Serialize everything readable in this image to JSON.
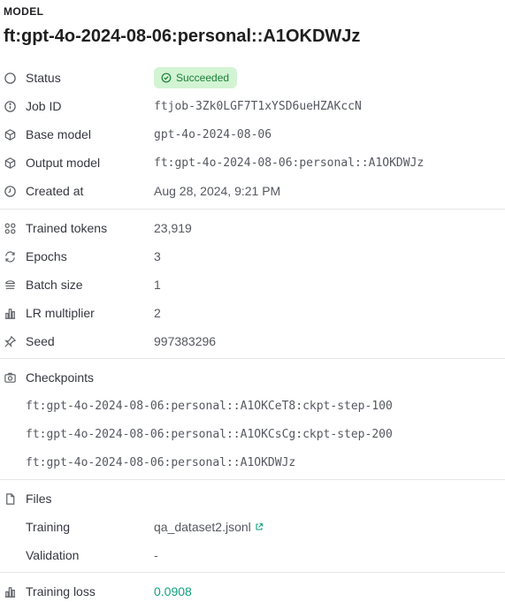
{
  "header": {
    "label": "MODEL",
    "title": "ft:gpt-4o-2024-08-06:personal::A1OKDWJz"
  },
  "details": {
    "status": {
      "label": "Status",
      "value": "Succeeded",
      "icon": "circle-icon"
    },
    "job_id": {
      "label": "Job ID",
      "value": "ftjob-3Zk0LGF7T1xYSD6ueHZAKccN",
      "icon": "info-icon"
    },
    "base_model": {
      "label": "Base model",
      "value": "gpt-4o-2024-08-06",
      "icon": "cube-icon"
    },
    "output_model": {
      "label": "Output model",
      "value": "ft:gpt-4o-2024-08-06:personal::A1OKDWJz",
      "icon": "cube-icon"
    },
    "created_at": {
      "label": "Created at",
      "value": "Aug 28, 2024, 9:21 PM",
      "icon": "clock-icon"
    }
  },
  "training": {
    "trained_tokens": {
      "label": "Trained tokens",
      "value": "23,919",
      "icon": "tokens-icon"
    },
    "epochs": {
      "label": "Epochs",
      "value": "3",
      "icon": "repeat-icon"
    },
    "batch_size": {
      "label": "Batch size",
      "value": "1",
      "icon": "stack-icon"
    },
    "lr_multiplier": {
      "label": "LR multiplier",
      "value": "2",
      "icon": "bar-chart-icon"
    },
    "seed": {
      "label": "Seed",
      "value": "997383296",
      "icon": "pin-icon"
    }
  },
  "checkpoints": {
    "label": "Checkpoints",
    "icon": "camera-icon",
    "items": [
      "ft:gpt-4o-2024-08-06:personal::A1OKCeT8:ckpt-step-100",
      "ft:gpt-4o-2024-08-06:personal::A1OKCsCg:ckpt-step-200",
      "ft:gpt-4o-2024-08-06:personal::A1OKDWJz"
    ]
  },
  "files": {
    "label": "Files",
    "icon": "file-icon",
    "training_label": "Training",
    "training_value": "qa_dataset2.jsonl",
    "validation_label": "Validation",
    "validation_value": "-"
  },
  "metrics": {
    "training_loss": {
      "label": "Training loss",
      "value": "0.0908",
      "icon": "bar-chart-icon"
    }
  },
  "colors": {
    "accent": "#10a37f",
    "badge_bg": "#d2f4d3",
    "badge_text": "#1a7f37",
    "divider": "#e6e6e6"
  }
}
